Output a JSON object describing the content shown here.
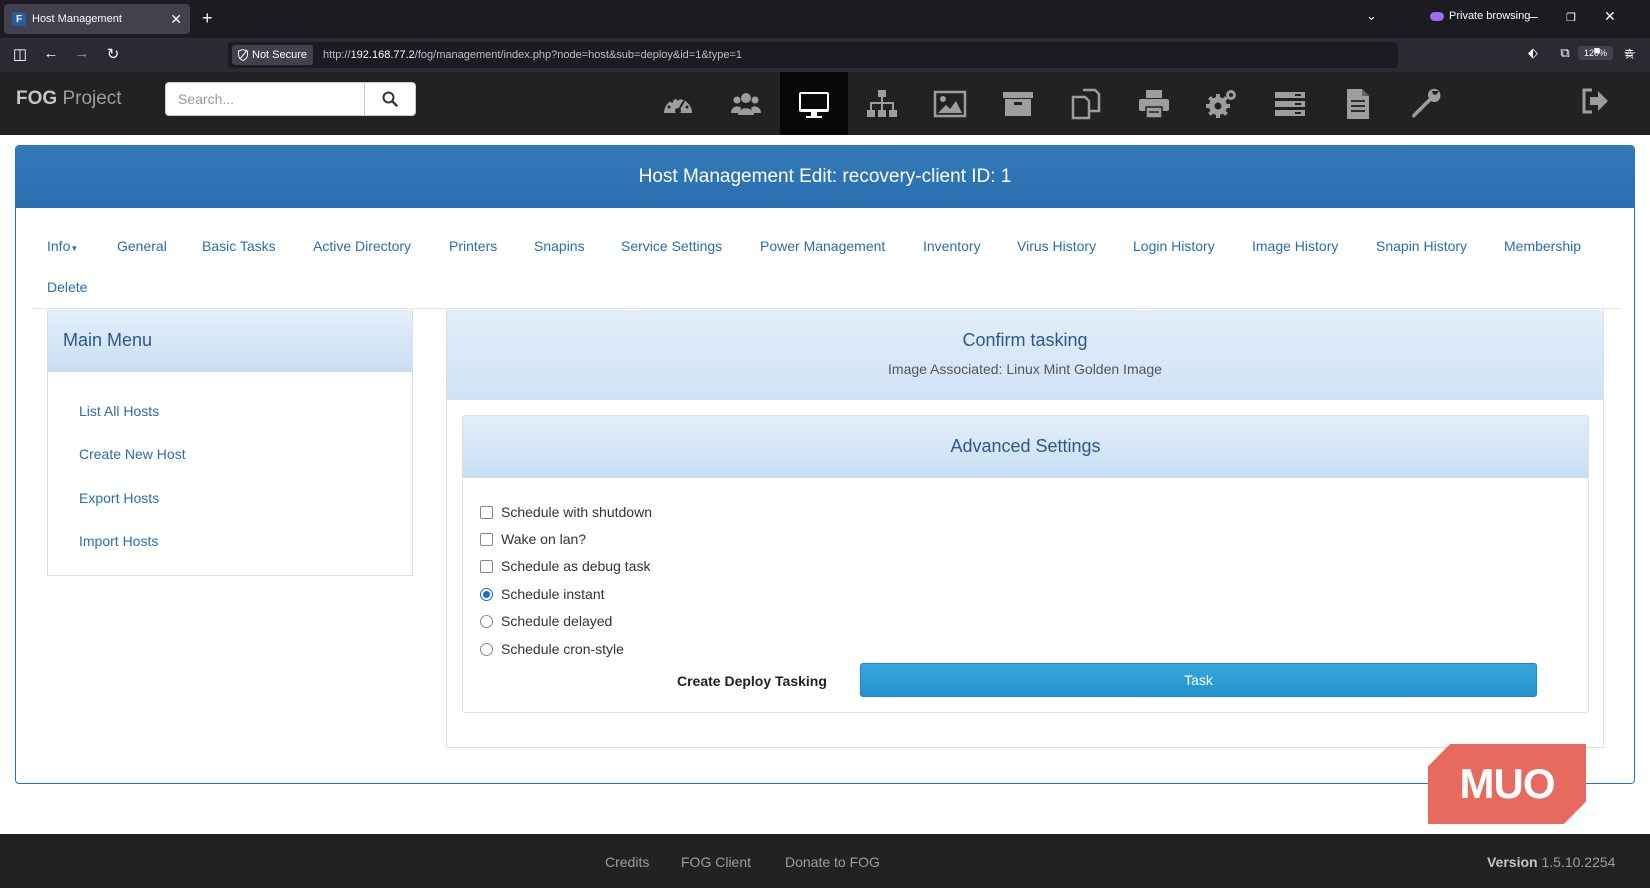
{
  "browser": {
    "tab_title": "Host Management",
    "tab_favicon": "F",
    "not_secure": "Not Secure",
    "url_prefix": "http://",
    "url_host": "192.168.77.2",
    "url_path": "/fog/management/index.php?node=host&sub=deploy&id=1&type=1",
    "zoom": "120%",
    "private_label": "Private browsing"
  },
  "header": {
    "brand_bold": "FOG",
    "brand_rest": " Project",
    "search_placeholder": "Search...",
    "nav_icons": [
      "dashboard-icon",
      "users-icon",
      "hosts-icon",
      "groups-icon",
      "images-icon",
      "storage-icon",
      "snapins-icon",
      "printers-icon",
      "services-icon",
      "tasks-icon",
      "reports-icon",
      "settings-icon"
    ],
    "active_nav": "hosts-icon"
  },
  "panel": {
    "title": "Host Management Edit: recovery-client ID: 1"
  },
  "subnav": {
    "items": [
      "Info",
      "General",
      "Basic Tasks",
      "Active Directory",
      "Printers",
      "Snapins",
      "Service Settings",
      "Power Management",
      "Inventory",
      "Virus History",
      "Login History",
      "Image History",
      "Snapin History",
      "Membership",
      "Delete"
    ]
  },
  "main_menu": {
    "title": "Main Menu",
    "items": [
      "List All Hosts",
      "Create New Host",
      "Export Hosts",
      "Import Hosts"
    ]
  },
  "confirm": {
    "title": "Confirm tasking",
    "image_associated": "Image Associated: Linux Mint Golden Image"
  },
  "advanced": {
    "title": "Advanced Settings",
    "checkboxes": [
      "Schedule with shutdown",
      "Wake on lan?",
      "Schedule as debug task"
    ],
    "radios": [
      "Schedule instant",
      "Schedule delayed",
      "Schedule cron-style"
    ],
    "selected_radio": "Schedule instant",
    "deploy_label": "Create Deploy Tasking",
    "task_button": "Task"
  },
  "watermark": "MUO",
  "footer": {
    "links": [
      "Credits",
      "FOG Client",
      "Donate to FOG"
    ],
    "version_label": "Version",
    "version_value": " 1.5.10.2254"
  },
  "colors": {
    "panel_head": "#337ab7",
    "link": "#2a6eb0",
    "task_button": "#2293cf"
  }
}
